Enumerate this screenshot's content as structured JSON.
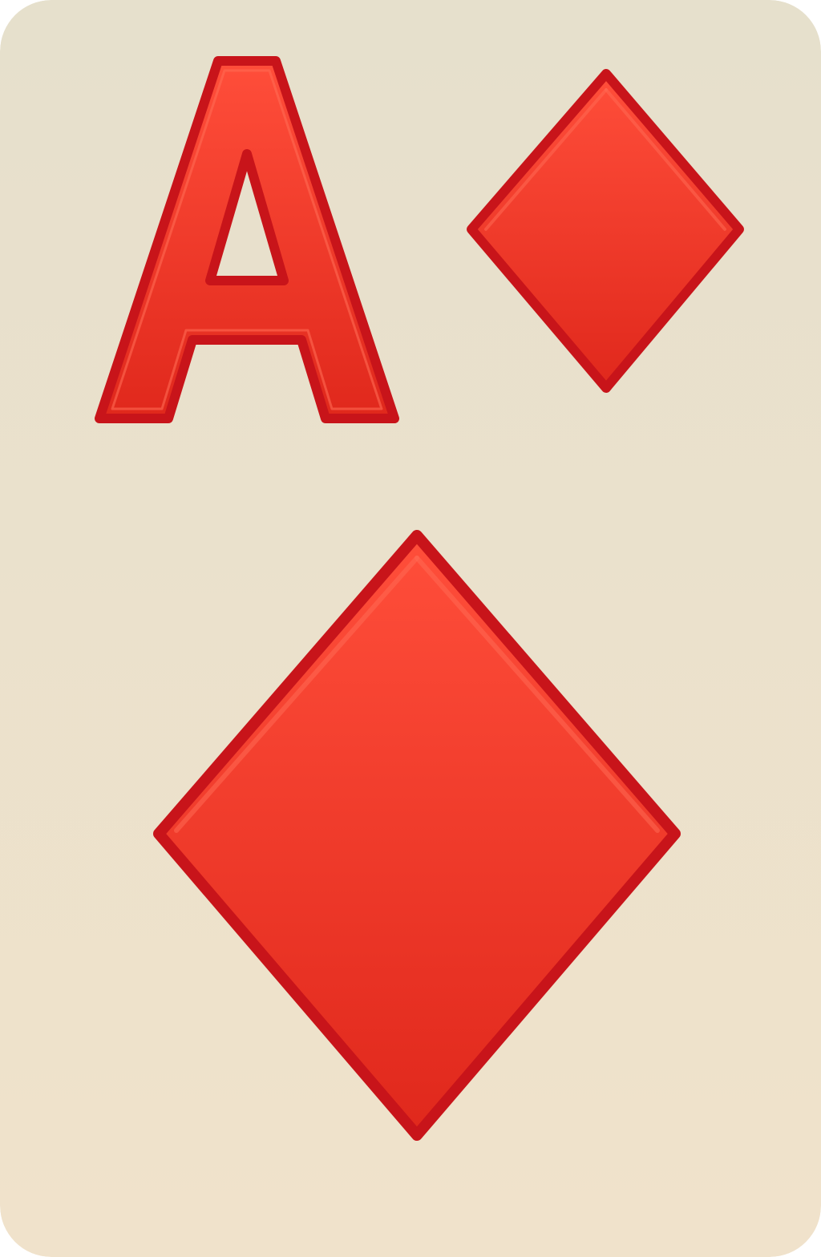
{
  "card": {
    "rank": "A",
    "suit": "diamonds",
    "suit_icon_corner": "diamond-suit-icon",
    "suit_icon_center": "diamond-suit-icon"
  },
  "colors": {
    "card_top": "#e6e0cc",
    "card_bottom": "#f0e2cb",
    "suit_fill_light": "#ff4e3a",
    "suit_fill_dark": "#e0281c",
    "suit_outline": "#c8141a"
  }
}
